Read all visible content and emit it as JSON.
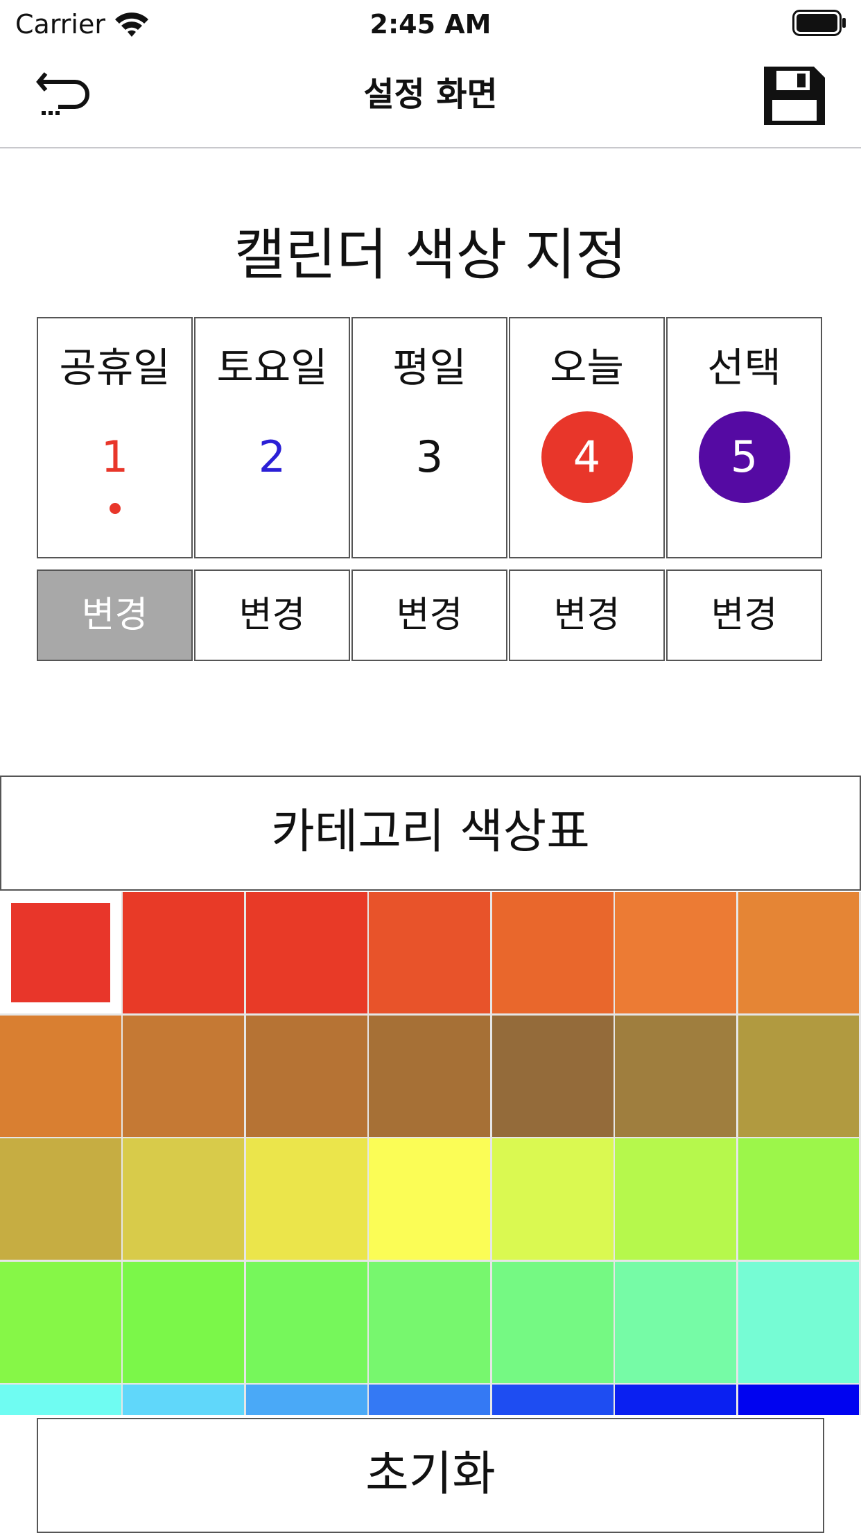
{
  "status_bar": {
    "carrier": "Carrier",
    "time": "2:45 AM"
  },
  "nav": {
    "title": "설정 화면",
    "back_icon": "undo-arrow-icon",
    "save_icon": "floppy-disk-icon"
  },
  "section_title": "캘린더 색상 지정",
  "calendar_cells": [
    {
      "label": "공휴일",
      "number": "1",
      "number_color": "#e8362a",
      "style": "text-dot",
      "dot_color": "#e8362a"
    },
    {
      "label": "토요일",
      "number": "2",
      "number_color": "#2b1fd6",
      "style": "text"
    },
    {
      "label": "평일",
      "number": "3",
      "number_color": "#111111",
      "style": "text"
    },
    {
      "label": "오늘",
      "number": "4",
      "circle_color": "#e8362a",
      "style": "circle"
    },
    {
      "label": "선택",
      "number": "5",
      "circle_color": "#550aa3",
      "style": "circle"
    }
  ],
  "change_buttons": [
    {
      "label": "변경",
      "active": true
    },
    {
      "label": "변경",
      "active": false
    },
    {
      "label": "변경",
      "active": false
    },
    {
      "label": "변경",
      "active": false
    },
    {
      "label": "변경",
      "active": false
    }
  ],
  "palette": {
    "header": "카테고리 색상표",
    "selected_index": 0,
    "rows": [
      [
        "#e8362a",
        "#e83a27",
        "#e83a27",
        "#e8532a",
        "#e9672c",
        "#ec7b34",
        "#e58535"
      ],
      [
        "#d97f31",
        "#c57934",
        "#b67334",
        "#a67036",
        "#946b3a",
        "#9f7e3e",
        "#b19a40"
      ],
      [
        "#c6ad42",
        "#d8cb4a",
        "#ebe54b",
        "#fbfd56",
        "#daf951",
        "#b6f84c",
        "#9cf64a"
      ],
      [
        "#86f747",
        "#7bf749",
        "#76f75b",
        "#77f76e",
        "#75f983",
        "#76fba6",
        "#76fcd4"
      ],
      [
        "#6ffcf2",
        "#60d7fa",
        "#4aa9f7",
        "#3479f4",
        "#1e4df2",
        "#0a20f1",
        "#0003f0"
      ]
    ]
  },
  "reset_button": "초기화"
}
